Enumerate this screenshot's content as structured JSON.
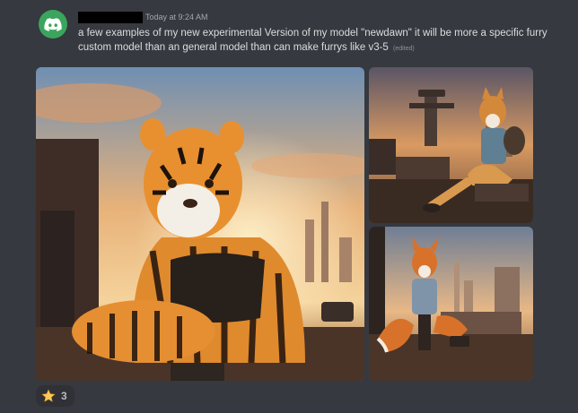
{
  "message": {
    "timestamp": "Today at 9:24 AM",
    "text": "a few examples of my new experimental Version of my model \"newdawn\" it will be more a specific furry custom model than an general model than can make furrys like v3-5",
    "edited_label": "(edited)"
  },
  "reactions": [
    {
      "emoji": "star-icon",
      "count": "3"
    }
  ],
  "colors": {
    "background": "#36393f",
    "avatar": "#3ba55d",
    "text": "#dcddde",
    "muted": "#a3a6aa",
    "reaction_bg": "#2f3136"
  }
}
